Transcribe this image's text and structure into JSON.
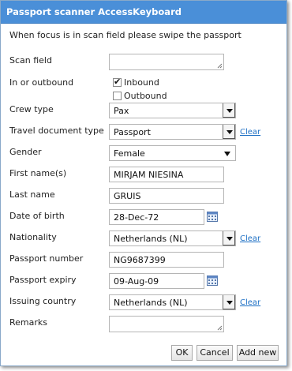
{
  "window": {
    "title": "Passport scanner AccessKeyboard",
    "instruction": "When focus is in scan field please swipe the passport",
    "accent_color": "#4a8fd8"
  },
  "labels": {
    "scan_field": "Scan field",
    "in_out": "In or outbound",
    "crew_type": "Crew type",
    "travel_doc_type": "Travel document type",
    "gender": "Gender",
    "first_names": "First name(s)",
    "last_name": "Last name",
    "dob": "Date of birth",
    "nationality": "Nationality",
    "passport_number": "Passport number",
    "passport_expiry": "Passport expiry",
    "issuing_country": "Issuing country",
    "remarks": "Remarks"
  },
  "fields": {
    "scan_field": "",
    "inbound": {
      "label": "Inbound",
      "checked": true
    },
    "outbound": {
      "label": "Outbound",
      "checked": false
    },
    "crew_type": "Pax",
    "travel_doc_type": "Passport",
    "gender": "Female",
    "first_names": "MIRJAM NIESINA",
    "last_name": "GRUIS",
    "dob": "28-Dec-72",
    "nationality": "Netherlands (NL)",
    "passport_number": "NG9687399",
    "passport_expiry": "09-Aug-09",
    "issuing_country": "Netherlands (NL)",
    "remarks": ""
  },
  "links": {
    "clear": "Clear"
  },
  "icons": {
    "calendar": "calendar-icon",
    "dropdown": "chevron-down-icon",
    "checkmark": "✔"
  },
  "buttons": {
    "ok": "OK",
    "cancel": "Cancel",
    "add_new": "Add new"
  }
}
